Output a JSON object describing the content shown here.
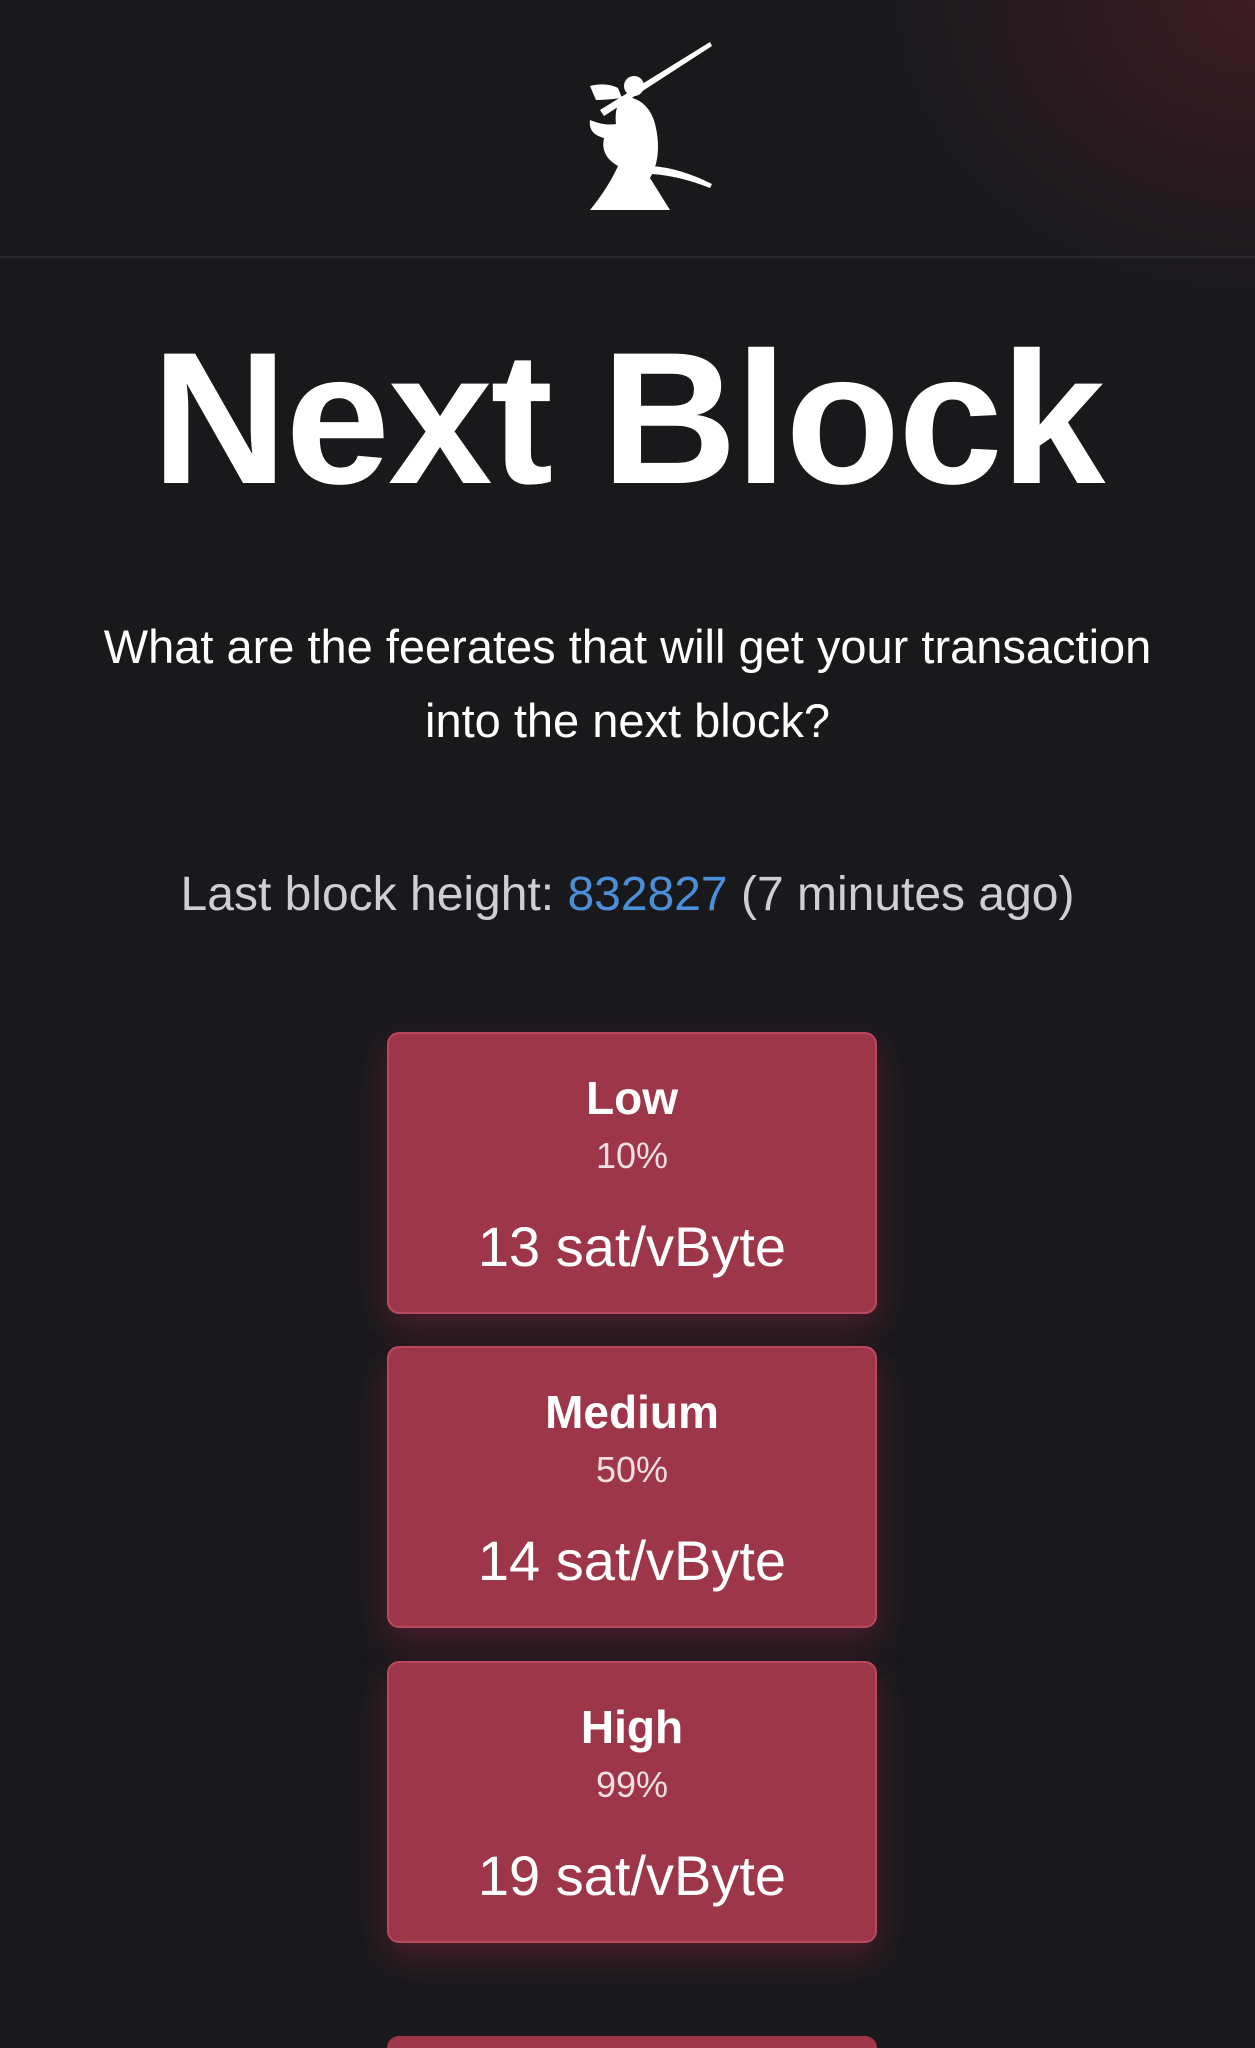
{
  "page": {
    "title": "Next Block",
    "subtitle": "What are the feerates that will get your transaction into the next block?",
    "last_block": {
      "prefix": "Last block height: ",
      "height": "832827",
      "suffix": " (7 minutes ago)"
    }
  },
  "feerates": [
    {
      "label": "Low",
      "percent": "10%",
      "rate": "13 sat/vByte"
    },
    {
      "label": "Medium",
      "percent": "50%",
      "rate": "14 sat/vByte"
    },
    {
      "label": "High",
      "percent": "99%",
      "rate": "19 sat/vByte"
    }
  ],
  "colors": {
    "background": "#19191c",
    "card": "#9e3649",
    "link": "#4a90d9"
  },
  "icons": {
    "logo": "samurai-logo-icon"
  }
}
